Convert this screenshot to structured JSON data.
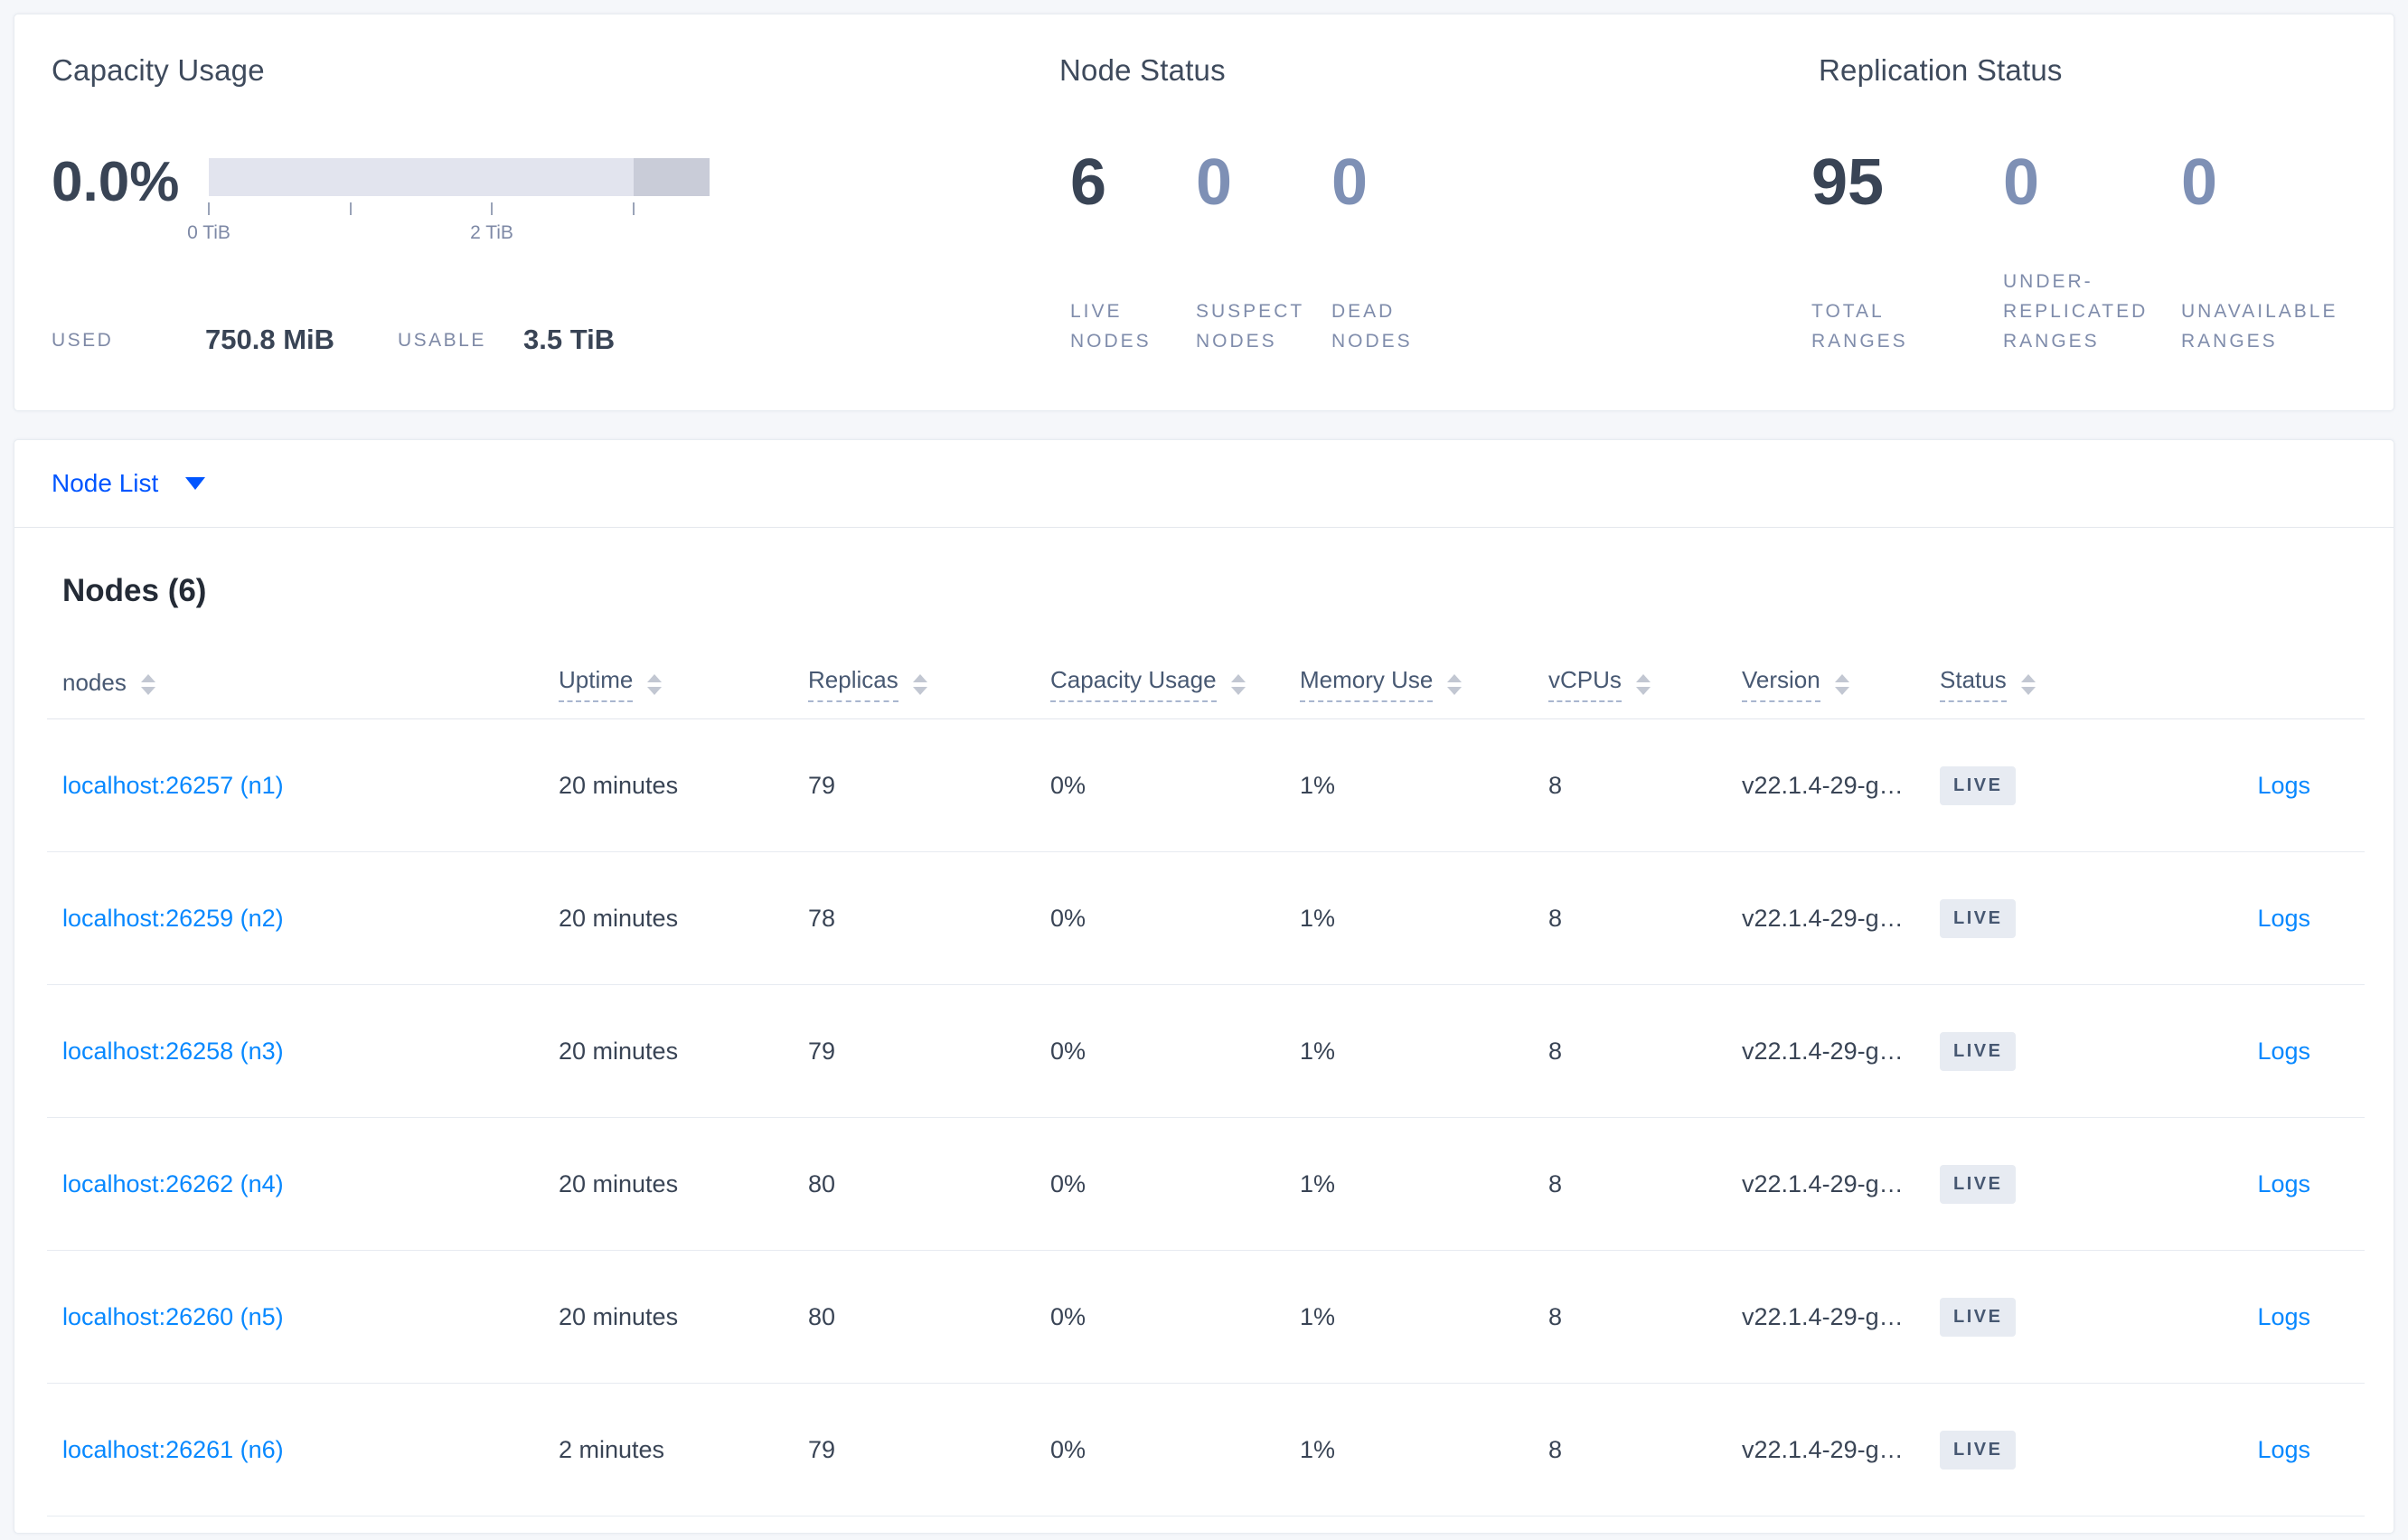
{
  "overview": {
    "capacity": {
      "title": "Capacity Usage",
      "percent": "0.0%",
      "axis_labels": [
        "0 TiB",
        "2 TiB"
      ],
      "used_label": "USED",
      "used_value": "750.8 MiB",
      "usable_label": "USABLE",
      "usable_value": "3.5 TiB"
    },
    "node_status": {
      "title": "Node Status",
      "stats": [
        {
          "value": "6",
          "label": "LIVE NODES"
        },
        {
          "value": "0",
          "label": "SUSPECT NODES"
        },
        {
          "value": "0",
          "label": "DEAD NODES"
        }
      ]
    },
    "replication": {
      "title": "Replication Status",
      "stats": [
        {
          "value": "95",
          "label": "TOTAL RANGES"
        },
        {
          "value": "0",
          "label": "UNDER-REPLICATED RANGES"
        },
        {
          "value": "0",
          "label": "UNAVAILABLE RANGES"
        }
      ]
    }
  },
  "node_list": {
    "toggle_label": "Node List",
    "heading": "Nodes (6)",
    "logs_label": "Logs",
    "columns": [
      "nodes",
      "Uptime",
      "Replicas",
      "Capacity Usage",
      "Memory Use",
      "vCPUs",
      "Version",
      "Status"
    ],
    "rows": [
      {
        "node": "localhost:26257 (n1)",
        "uptime": "20 minutes",
        "replicas": "79",
        "capacity": "0%",
        "memory": "1%",
        "vcpus": "8",
        "version": "v22.1.4-29-g…",
        "status": "LIVE"
      },
      {
        "node": "localhost:26259 (n2)",
        "uptime": "20 minutes",
        "replicas": "78",
        "capacity": "0%",
        "memory": "1%",
        "vcpus": "8",
        "version": "v22.1.4-29-g…",
        "status": "LIVE"
      },
      {
        "node": "localhost:26258 (n3)",
        "uptime": "20 minutes",
        "replicas": "79",
        "capacity": "0%",
        "memory": "1%",
        "vcpus": "8",
        "version": "v22.1.4-29-g…",
        "status": "LIVE"
      },
      {
        "node": "localhost:26262 (n4)",
        "uptime": "20 minutes",
        "replicas": "80",
        "capacity": "0%",
        "memory": "1%",
        "vcpus": "8",
        "version": "v22.1.4-29-g…",
        "status": "LIVE"
      },
      {
        "node": "localhost:26260 (n5)",
        "uptime": "20 minutes",
        "replicas": "80",
        "capacity": "0%",
        "memory": "1%",
        "vcpus": "8",
        "version": "v22.1.4-29-g…",
        "status": "LIVE"
      },
      {
        "node": "localhost:26261 (n6)",
        "uptime": "2 minutes",
        "replicas": "79",
        "capacity": "0%",
        "memory": "1%",
        "vcpus": "8",
        "version": "v22.1.4-29-g…",
        "status": "LIVE"
      }
    ]
  },
  "colors": {
    "page_background": "#f5f7fa",
    "accent_blue": "#0055ff",
    "link_blue": "#0788ff",
    "dark_text": "#394455",
    "muted_label": "#7f8cab",
    "zero_stat": "#7e90b5",
    "badge_background": "#e7ebf2",
    "bar_light": "#e2e4ee",
    "bar_dark": "#c9ccd8"
  }
}
